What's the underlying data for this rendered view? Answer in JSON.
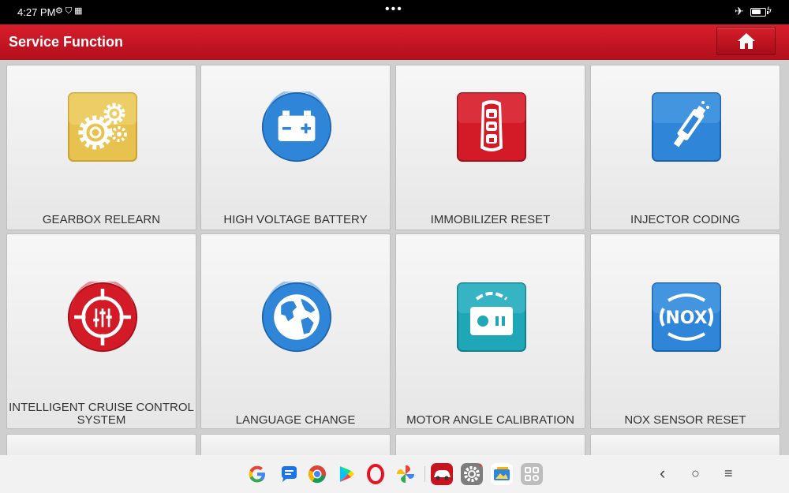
{
  "status_bar": {
    "time": "4:27 PM",
    "status_icons": [
      "gear-small-icon",
      "shield-icon",
      "grid-small-icon"
    ],
    "center_dots": "•••",
    "airplane_icon": "airplane-icon",
    "battery_level_percent": 70,
    "charging_icon": "lightning-icon"
  },
  "header": {
    "title": "Service Function",
    "home_icon": "home-icon"
  },
  "tiles": [
    {
      "label": "GEARBOX RELEARN",
      "icon": "gears-icon",
      "color": "#e7c24f"
    },
    {
      "label": "HIGH VOLTAGE BATTERY",
      "icon": "battery-icon",
      "color": "#2f86d8"
    },
    {
      "label": "IMMOBILIZER RESET",
      "icon": "car-key-icon",
      "color": "#d31b28"
    },
    {
      "label": "INJECTOR CODING",
      "icon": "injector-icon",
      "color": "#2f86d8"
    },
    {
      "label": "INTELLIGENT CRUISE CONTROL SYSTEM",
      "icon": "target-sliders-icon",
      "color": "#d31b28"
    },
    {
      "label": "LANGUAGE CHANGE",
      "icon": "globe-icon",
      "color": "#2f86d8"
    },
    {
      "label": "MOTOR ANGLE CALIBRATION",
      "icon": "motor-sensor-icon",
      "color": "#1fa7b7"
    },
    {
      "label": "NOX SENSOR RESET",
      "icon": "nox-icon",
      "color": "#2f86d8"
    }
  ],
  "label_pieces": {
    "cruise_line1": "INTELLIGENT CRUISE CONTROL",
    "cruise_line2": "SYSTEM"
  },
  "nox_text": "NOX",
  "dock": {
    "apps": [
      "google-icon",
      "messages-icon",
      "chrome-icon",
      "play-store-icon",
      "opera-icon",
      "photos-icon",
      "car-diagnostic-icon",
      "settings-icon",
      "gallery-icon",
      "app-drawer-icon"
    ]
  },
  "nav": {
    "back": "‹",
    "home": "○",
    "recents": "≡"
  },
  "colors": {
    "header_red": "#c8141f",
    "status_bar": "#000000",
    "tile_bg": "#eeeeee",
    "page_bg": "#cfcfcf"
  }
}
